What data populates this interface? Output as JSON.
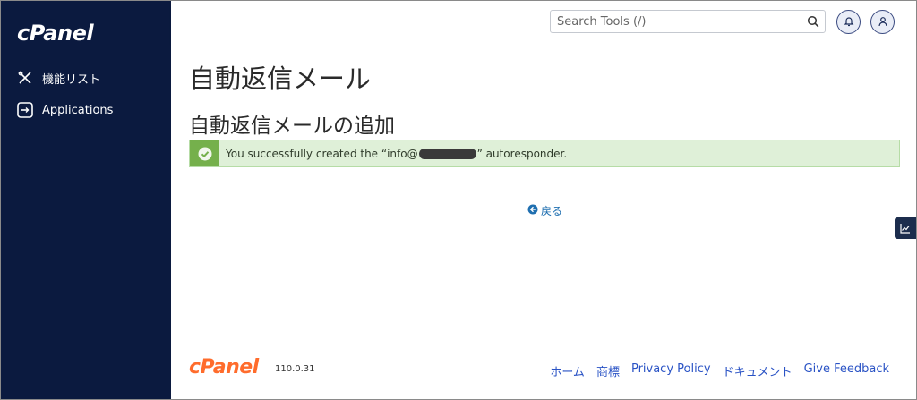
{
  "sidebar": {
    "logo": "cPanel",
    "items": [
      {
        "label": "機能リスト",
        "icon": "tools-icon"
      },
      {
        "label": "Applications",
        "icon": "applications-icon"
      }
    ]
  },
  "header": {
    "search_placeholder": "Search Tools (/)",
    "search_icon": "search-icon",
    "notifications_icon": "bell-icon",
    "user_icon": "user-icon"
  },
  "main": {
    "page_title": "自動返信メール",
    "section_title": "自動返信メールの追加",
    "alert": {
      "prefix": "You successfully created the “info@",
      "suffix": "” autoresponder.",
      "icon": "check-circle-icon"
    },
    "back_label": "戻る",
    "stats_icon": "chart-icon"
  },
  "footer": {
    "logo": "cPanel",
    "version": "110.0.31",
    "links": [
      "ホーム",
      "商標",
      "Privacy Policy",
      "ドキュメント",
      "Give Feedback"
    ]
  },
  "colors": {
    "sidebar_bg": "#0b1a3f",
    "alert_bg": "#dff0d8",
    "alert_icon_bg": "#75b04c",
    "footer_logo": "#ff6c2c",
    "link": "#2a53c5"
  }
}
